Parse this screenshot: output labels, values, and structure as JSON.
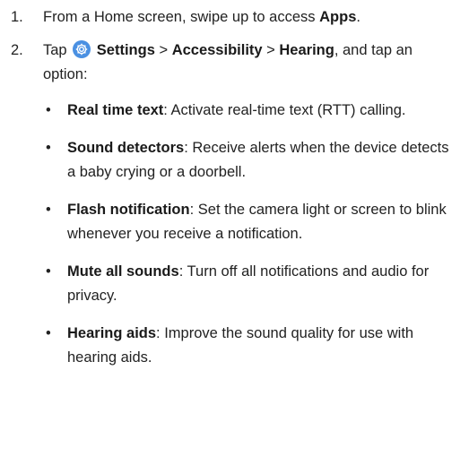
{
  "steps": [
    {
      "number": "1.",
      "prefix": "From a Home screen, swipe up to access ",
      "bold": "Apps",
      "suffix": "."
    },
    {
      "number": "2.",
      "prefix": "Tap ",
      "icon": "settings-gear-icon",
      "bold_settings": "Settings",
      "sep1": " > ",
      "bold_accessibility": "Accessibility",
      "sep2": " > ",
      "bold_hearing": "Hearing",
      "suffix": ", and tap an option:"
    }
  ],
  "bullet_char": "•",
  "options": [
    {
      "term": "Real time text",
      "desc": ": Activate real-time text (RTT) calling."
    },
    {
      "term": "Sound detectors",
      "desc": ": Receive alerts when the device detects a baby crying or a doorbell."
    },
    {
      "term": "Flash notification",
      "desc": ": Set the camera light or screen to blink whenever you receive a notification."
    },
    {
      "term": "Mute all sounds",
      "desc": ": Turn off all notifications and audio for privacy."
    },
    {
      "term": "Hearing aids",
      "desc": ": Improve the sound quality for use with hearing aids."
    }
  ],
  "colors": {
    "text": "#222222",
    "icon": "#4a90e2"
  }
}
